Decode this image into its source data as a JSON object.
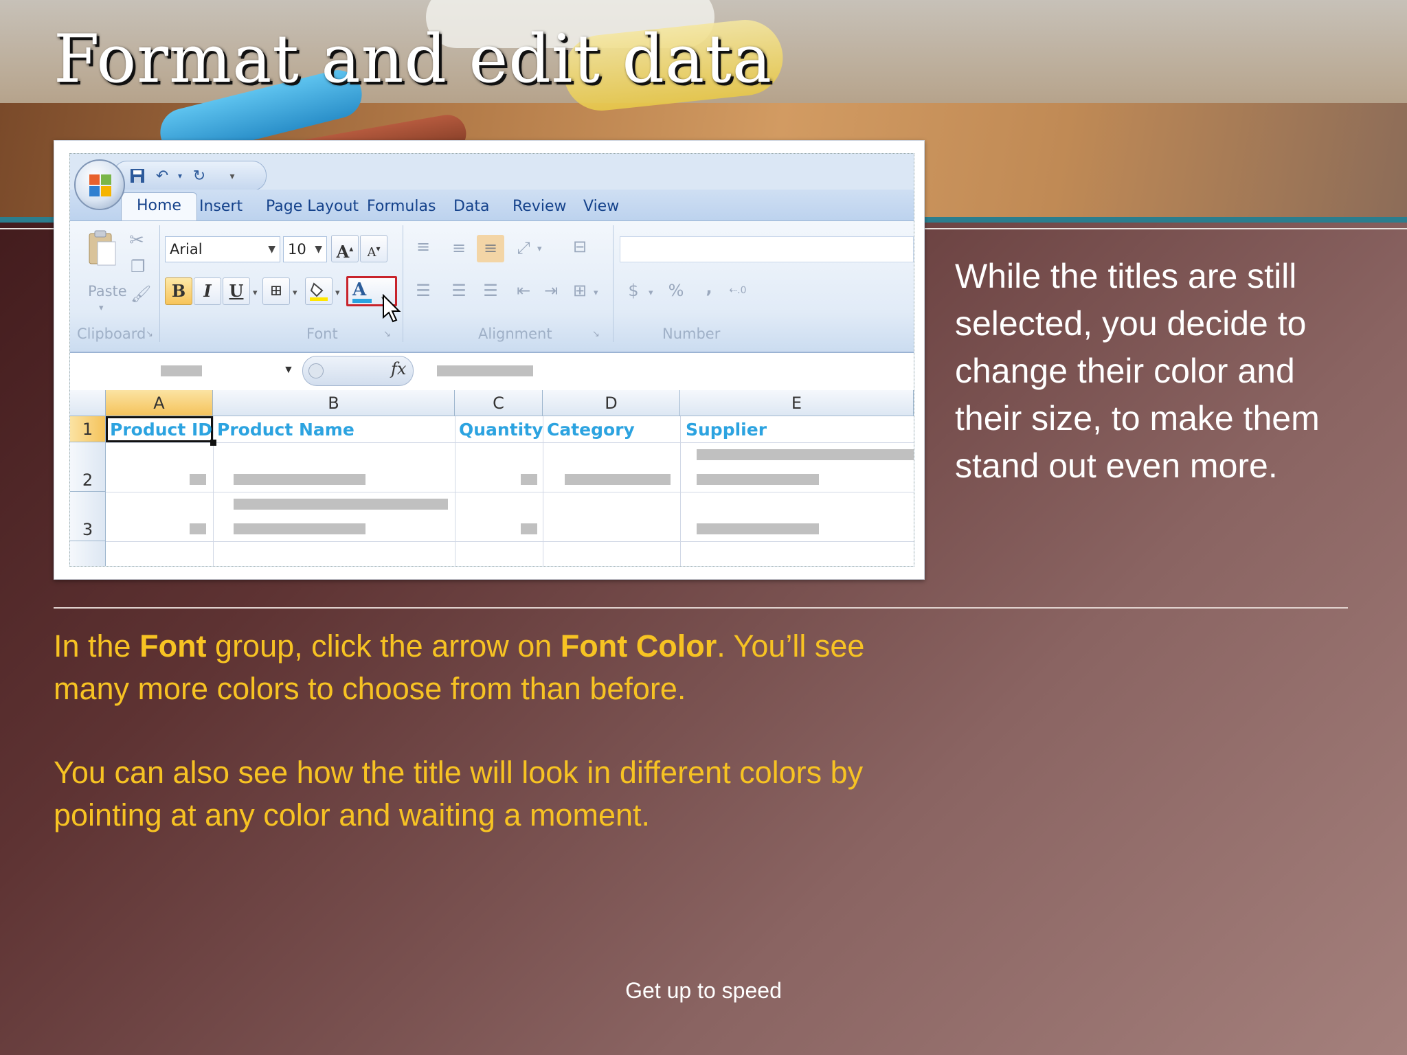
{
  "slide": {
    "title": "Format and edit data",
    "side_text": "While the titles are still selected, you decide to change their color and their size, to make them stand out even more.",
    "instruction_1": {
      "pre": "In the ",
      "b1": "Font",
      "mid": " group, click the arrow on ",
      "b2": "Font Color",
      "post": ". You’ll see many more colors to choose from than before."
    },
    "instruction_2": "You can also see how the title will look in different colors by pointing at any color and waiting a moment.",
    "footer": "Get up to speed"
  },
  "excel": {
    "tabs": [
      "Home",
      "Insert",
      "Page Layout",
      "Formulas",
      "Data",
      "Review",
      "View"
    ],
    "active_tab": "Home",
    "ribbon": {
      "paste_label": "Paste",
      "groups": [
        "Clipboard",
        "Font",
        "Alignment",
        "Number"
      ],
      "font_name": "Arial",
      "font_size": "10",
      "bold": "B",
      "italic": "I",
      "underline": "U",
      "font_color_glyph": "A",
      "grow_font": "A",
      "shrink_font": "A",
      "currency": "$",
      "percent": "%",
      "comma": ","
    },
    "formula_bar": {
      "fx": "fx"
    },
    "columns": [
      "A",
      "B",
      "C",
      "D",
      "E"
    ],
    "rows": [
      "1",
      "2",
      "3"
    ],
    "headers": [
      "Product ID",
      "Product Name",
      "Quantity",
      "Category",
      "Supplier"
    ],
    "colors": {
      "header_text": "#2ca3e0",
      "selected_header": "#f5c35b",
      "font_color_red_box": "#c8232b"
    }
  },
  "colors": {
    "instruction_text": "#f7c323",
    "teal_rule": "#2b7e8e"
  }
}
